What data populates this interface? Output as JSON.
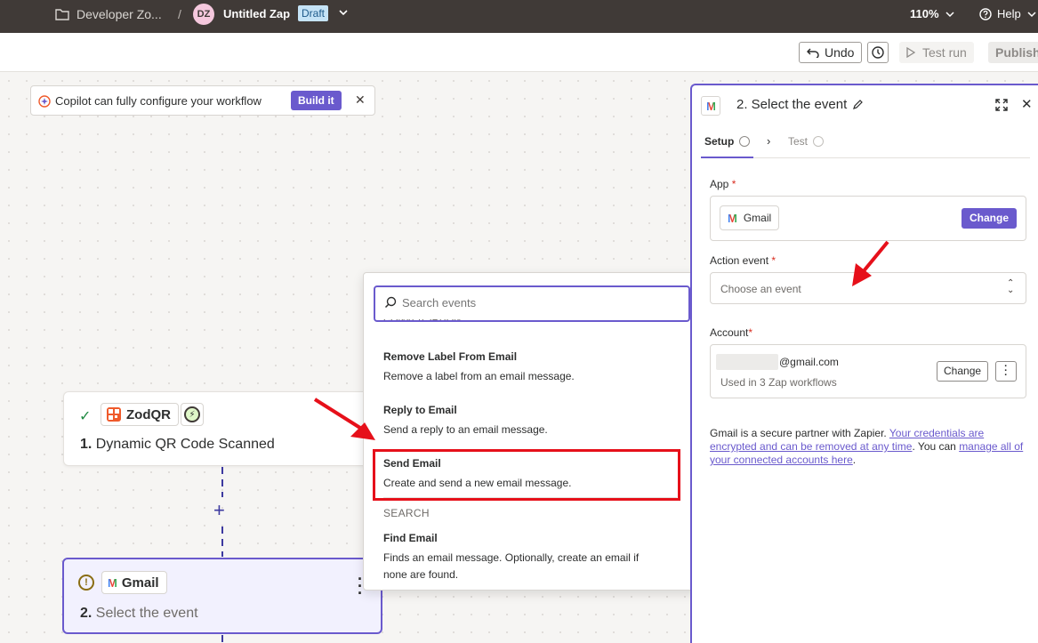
{
  "header": {
    "folder": "Developer Zo...",
    "separator": "/",
    "avatar_initials": "DZ",
    "zap_title": "Untitled Zap",
    "badge": "Draft",
    "zoom": "110%",
    "help": "Help"
  },
  "toolbar": {
    "undo": "Undo",
    "test_run": "Test run",
    "publish": "Publish"
  },
  "copilot": {
    "text": "Copilot can fully configure your workflow",
    "button": "Build it"
  },
  "steps": [
    {
      "app": "ZodQR",
      "number": "1.",
      "title": "Dynamic QR Code Scanned"
    },
    {
      "app": "Gmail",
      "number": "2.",
      "title": "Select the event"
    }
  ],
  "dropdown": {
    "placeholder": "Search events",
    "cut_label": "CONVERSATION",
    "events": [
      {
        "name": "Remove Label From Email",
        "desc": "Remove a label from an email message."
      },
      {
        "name": "Reply to Email",
        "desc": "Send a reply to an email message."
      },
      {
        "name": "Send Email",
        "desc": "Create and send a new email message."
      }
    ],
    "group": "SEARCH",
    "search_events": [
      {
        "name": "Find Email",
        "desc1": "Finds an email message. Optionally, create an email if",
        "desc2": "none are found."
      }
    ]
  },
  "panel": {
    "title": "2. Select the event",
    "tab_setup": "Setup",
    "tab_test": "Test",
    "app_label": "App",
    "app_name": "Gmail",
    "change": "Change",
    "action_label": "Action event",
    "action_placeholder": "Choose an event",
    "account_label": "Account",
    "account_email": "@gmail.com",
    "account_used": "Used in 3 Zap workflows",
    "account_change": "Change",
    "partner_text1": "Gmail is a secure partner with Zapier. ",
    "partner_link1": "Your credentials are encrypted and can be removed at any time",
    "partner_text2": ". You can ",
    "partner_link2": "manage all of your connected accounts here",
    "partner_text3": "."
  },
  "colors": {
    "accent": "#6a5acd",
    "header_bg": "#403a37",
    "annotation_red": "#e6101a"
  }
}
